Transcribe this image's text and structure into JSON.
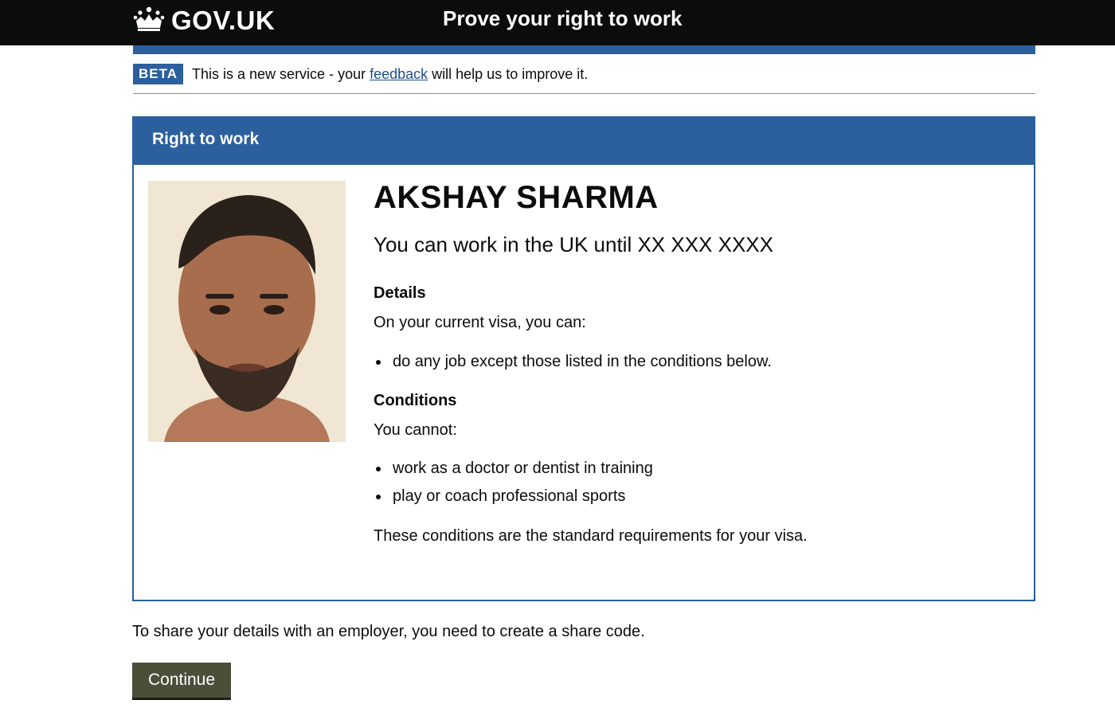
{
  "header": {
    "logo_text": "GOV.UK",
    "logo_icon": "crown-icon",
    "service_name": "Prove your right to work"
  },
  "phase_banner": {
    "tag": "BETA",
    "text_before": "This is a new service - your ",
    "link_text": "feedback",
    "text_after": " will help us to improve it."
  },
  "card": {
    "title": "Right to work",
    "photo": "person-photo",
    "name": "AKSHAY SHARMA",
    "work_until": "You can work in the UK until XX XXX XXXX",
    "details": {
      "heading": "Details",
      "intro": "On your current visa, you can:",
      "items": [
        "do any job except those listed in the conditions below."
      ]
    },
    "conditions": {
      "heading": "Conditions",
      "intro": "You cannot:",
      "items": [
        "work as a doctor or dentist in training",
        "play or coach professional sports"
      ],
      "footer": "These conditions are the standard requirements for your visa."
    }
  },
  "share_text": "To share your details with an employer, you need to create a share code.",
  "continue_label": "Continue",
  "colors": {
    "header_bg": "#0b0c0c",
    "brand_blue": "#2b5f9e",
    "button_bg": "#4b4f3a"
  }
}
